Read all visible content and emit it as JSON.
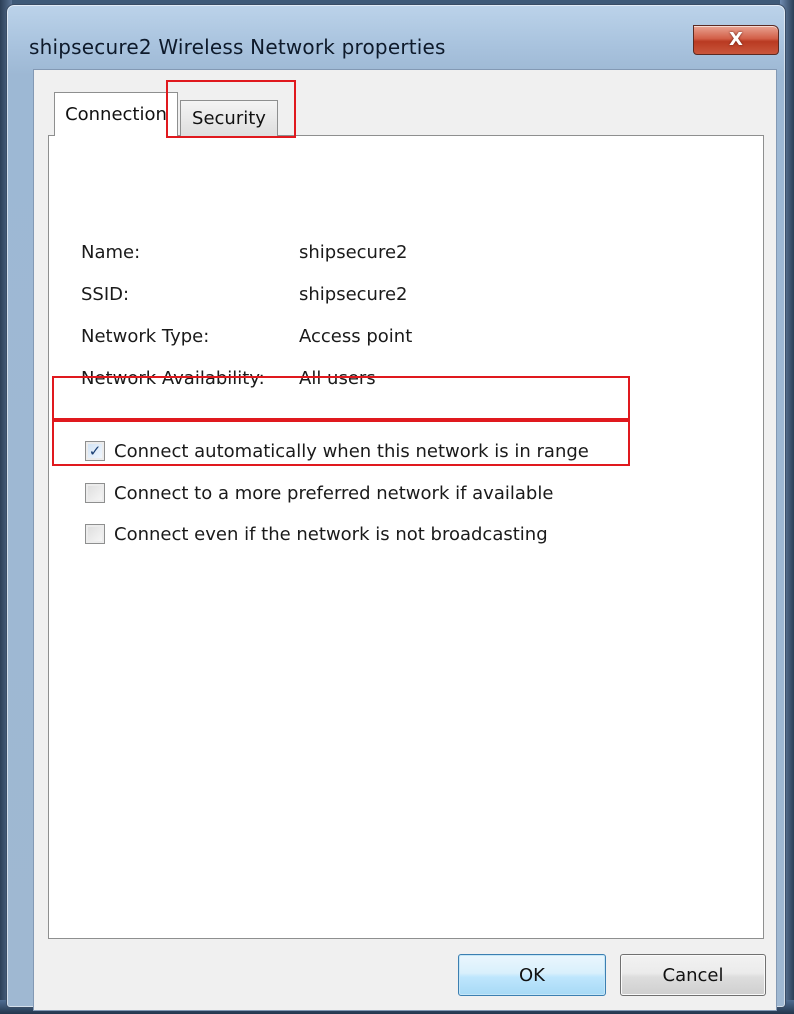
{
  "window": {
    "title": "shipsecure2 Wireless Network properties",
    "close_glyph": "X"
  },
  "tabs": [
    {
      "label": "Connection",
      "selected": true
    },
    {
      "label": "Security",
      "selected": false
    }
  ],
  "info": [
    {
      "label": "Name:",
      "value": "shipsecure2"
    },
    {
      "label": "SSID:",
      "value": "shipsecure2"
    },
    {
      "label": "Network Type:",
      "value": "Access point"
    },
    {
      "label": "Network Availability:",
      "value": "All users"
    }
  ],
  "options": [
    {
      "label": "Connect automatically when this network is in range",
      "checked": true
    },
    {
      "label": "Connect to a more preferred network if available",
      "checked": false
    },
    {
      "label": "Connect even if the network is not broadcasting",
      "checked": false
    }
  ],
  "buttons": {
    "ok": "OK",
    "cancel": "Cancel"
  },
  "icons": {
    "close": "close-icon",
    "checkmark": "checkmark-icon"
  },
  "colors": {
    "annotation": "#e0191e",
    "close_button": "#c9563c",
    "ok_border": "#3c7fb1"
  }
}
